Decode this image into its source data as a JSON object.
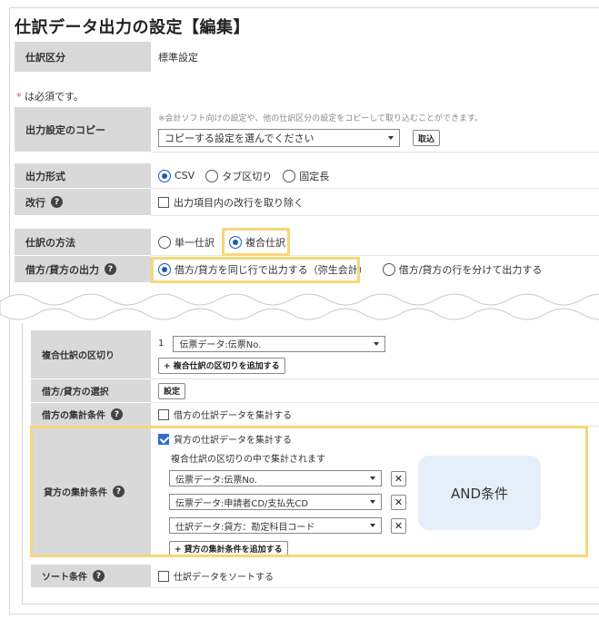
{
  "title": "仕訳データ出力の設定【編集】",
  "journal_type": {
    "label": "仕訳区分",
    "value": "標準設定"
  },
  "required_note": {
    "mark": "*",
    "text": " は必須です。"
  },
  "copy_settings": {
    "label": "出力設定のコピー",
    "note": "※会計ソフト向けの設定や、他の仕訳区分の設定をコピーして取り込むことができます。",
    "placeholder": "コピーする設定を選んでください",
    "import_button": "取込"
  },
  "output_format": {
    "label": "出力形式",
    "options": [
      {
        "label": "CSV",
        "selected": true
      },
      {
        "label": "タブ区切り",
        "selected": false
      },
      {
        "label": "固定長",
        "selected": false
      }
    ]
  },
  "line_break": {
    "label": "改行",
    "checkbox_label": "出力項目内の改行を取り除く",
    "checked": false
  },
  "journal_method": {
    "label": "仕訳の方法",
    "options": [
      {
        "label": "単一仕訳",
        "selected": false
      },
      {
        "label": "複合仕訳",
        "selected": true
      }
    ]
  },
  "debit_credit_output": {
    "label": "借方/貸方の出力",
    "options": [
      {
        "label": "借方/貸方を同じ行で出力する（弥生会計）",
        "selected": true
      },
      {
        "label": "借方/貸方の行を分けて出力する",
        "selected": false
      }
    ]
  },
  "compound_split": {
    "label": "複合仕訳の区切り",
    "index": "1",
    "select_value": "伝票データ:伝票No.",
    "add_button": "+ 複合仕訳の区切りを追加する"
  },
  "debit_credit_select": {
    "label": "借方/貸方の選択",
    "button": "設定"
  },
  "debit_aggregate": {
    "label": "借方の集計条件",
    "checkbox_label": "借方の仕訳データを集計する",
    "checked": false
  },
  "credit_aggregate": {
    "label": "貸方の集計条件",
    "checkbox_label": "貸方の仕訳データを集計する",
    "checked": true,
    "note": "複合仕訳の区切りの中で集計されます",
    "conditions": [
      "伝票データ:伝票No.",
      "伝票データ:申請者CD/支払先CD",
      "仕訳データ:貸方：勘定科目コード"
    ],
    "remove_label": "✕",
    "add_button": "+ 貸方の集計条件を追加する"
  },
  "and_callout": "AND条件",
  "sort": {
    "label": "ソート条件",
    "checkbox_label": "仕訳データをソートする",
    "checked": false
  },
  "help_glyph": "?",
  "colors": {
    "highlight": "#f6d77a",
    "radio_selected": "#1a5bb8",
    "required": "#d9534f",
    "label_bg": "#d9d9d9"
  }
}
